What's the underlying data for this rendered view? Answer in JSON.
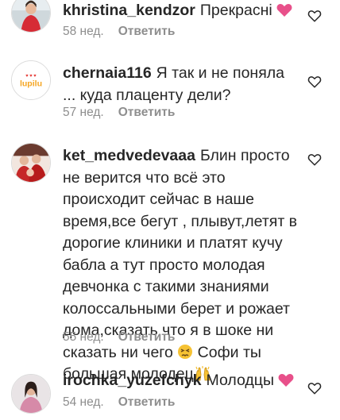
{
  "comments": [
    {
      "username": "khristina_kendzor",
      "text": "Прекрасні",
      "emoji_after": "pink-heart",
      "time": "58 нед.",
      "reply_label": "Ответить",
      "avatar_icon": "avatar-woman-red"
    },
    {
      "username": "chernaia116",
      "text": "Я так и не поняла ... куда плаценту дели?",
      "time": "57 нед.",
      "reply_label": "Ответить",
      "avatar_icon": "avatar-logo",
      "avatar_logo_text": "lupilu"
    },
    {
      "username": "ket_medvedevaaa",
      "text_line1": "Блин просто не верится что всё это происходит сейчас в наше время,все бегут , плывут,летят в дорогие клиники и платят кучу бабла а тут просто молодая девчонка с такими знаниями колоссальными берет и рожает дома,сказать что я в шоке ни сказать ни чего",
      "text_line2": "Софи ты большая молодец",
      "emoji_mid": "persevering-face",
      "emoji_end": "raising-hands",
      "time": "55 нед.",
      "reply_label": "Ответить",
      "avatar_icon": "avatar-family"
    },
    {
      "username": "irochka_yuzefchyk",
      "text": "Молодцы",
      "emoji_after": "pink-heart",
      "time": "54 нед.",
      "reply_label": "Ответить",
      "avatar_icon": "avatar-woman-pink"
    }
  ],
  "like_icon": "heart-outline-icon",
  "colors": {
    "text": "#262626",
    "muted": "#8e8e8e",
    "heart_emoji": "#e8508a"
  }
}
